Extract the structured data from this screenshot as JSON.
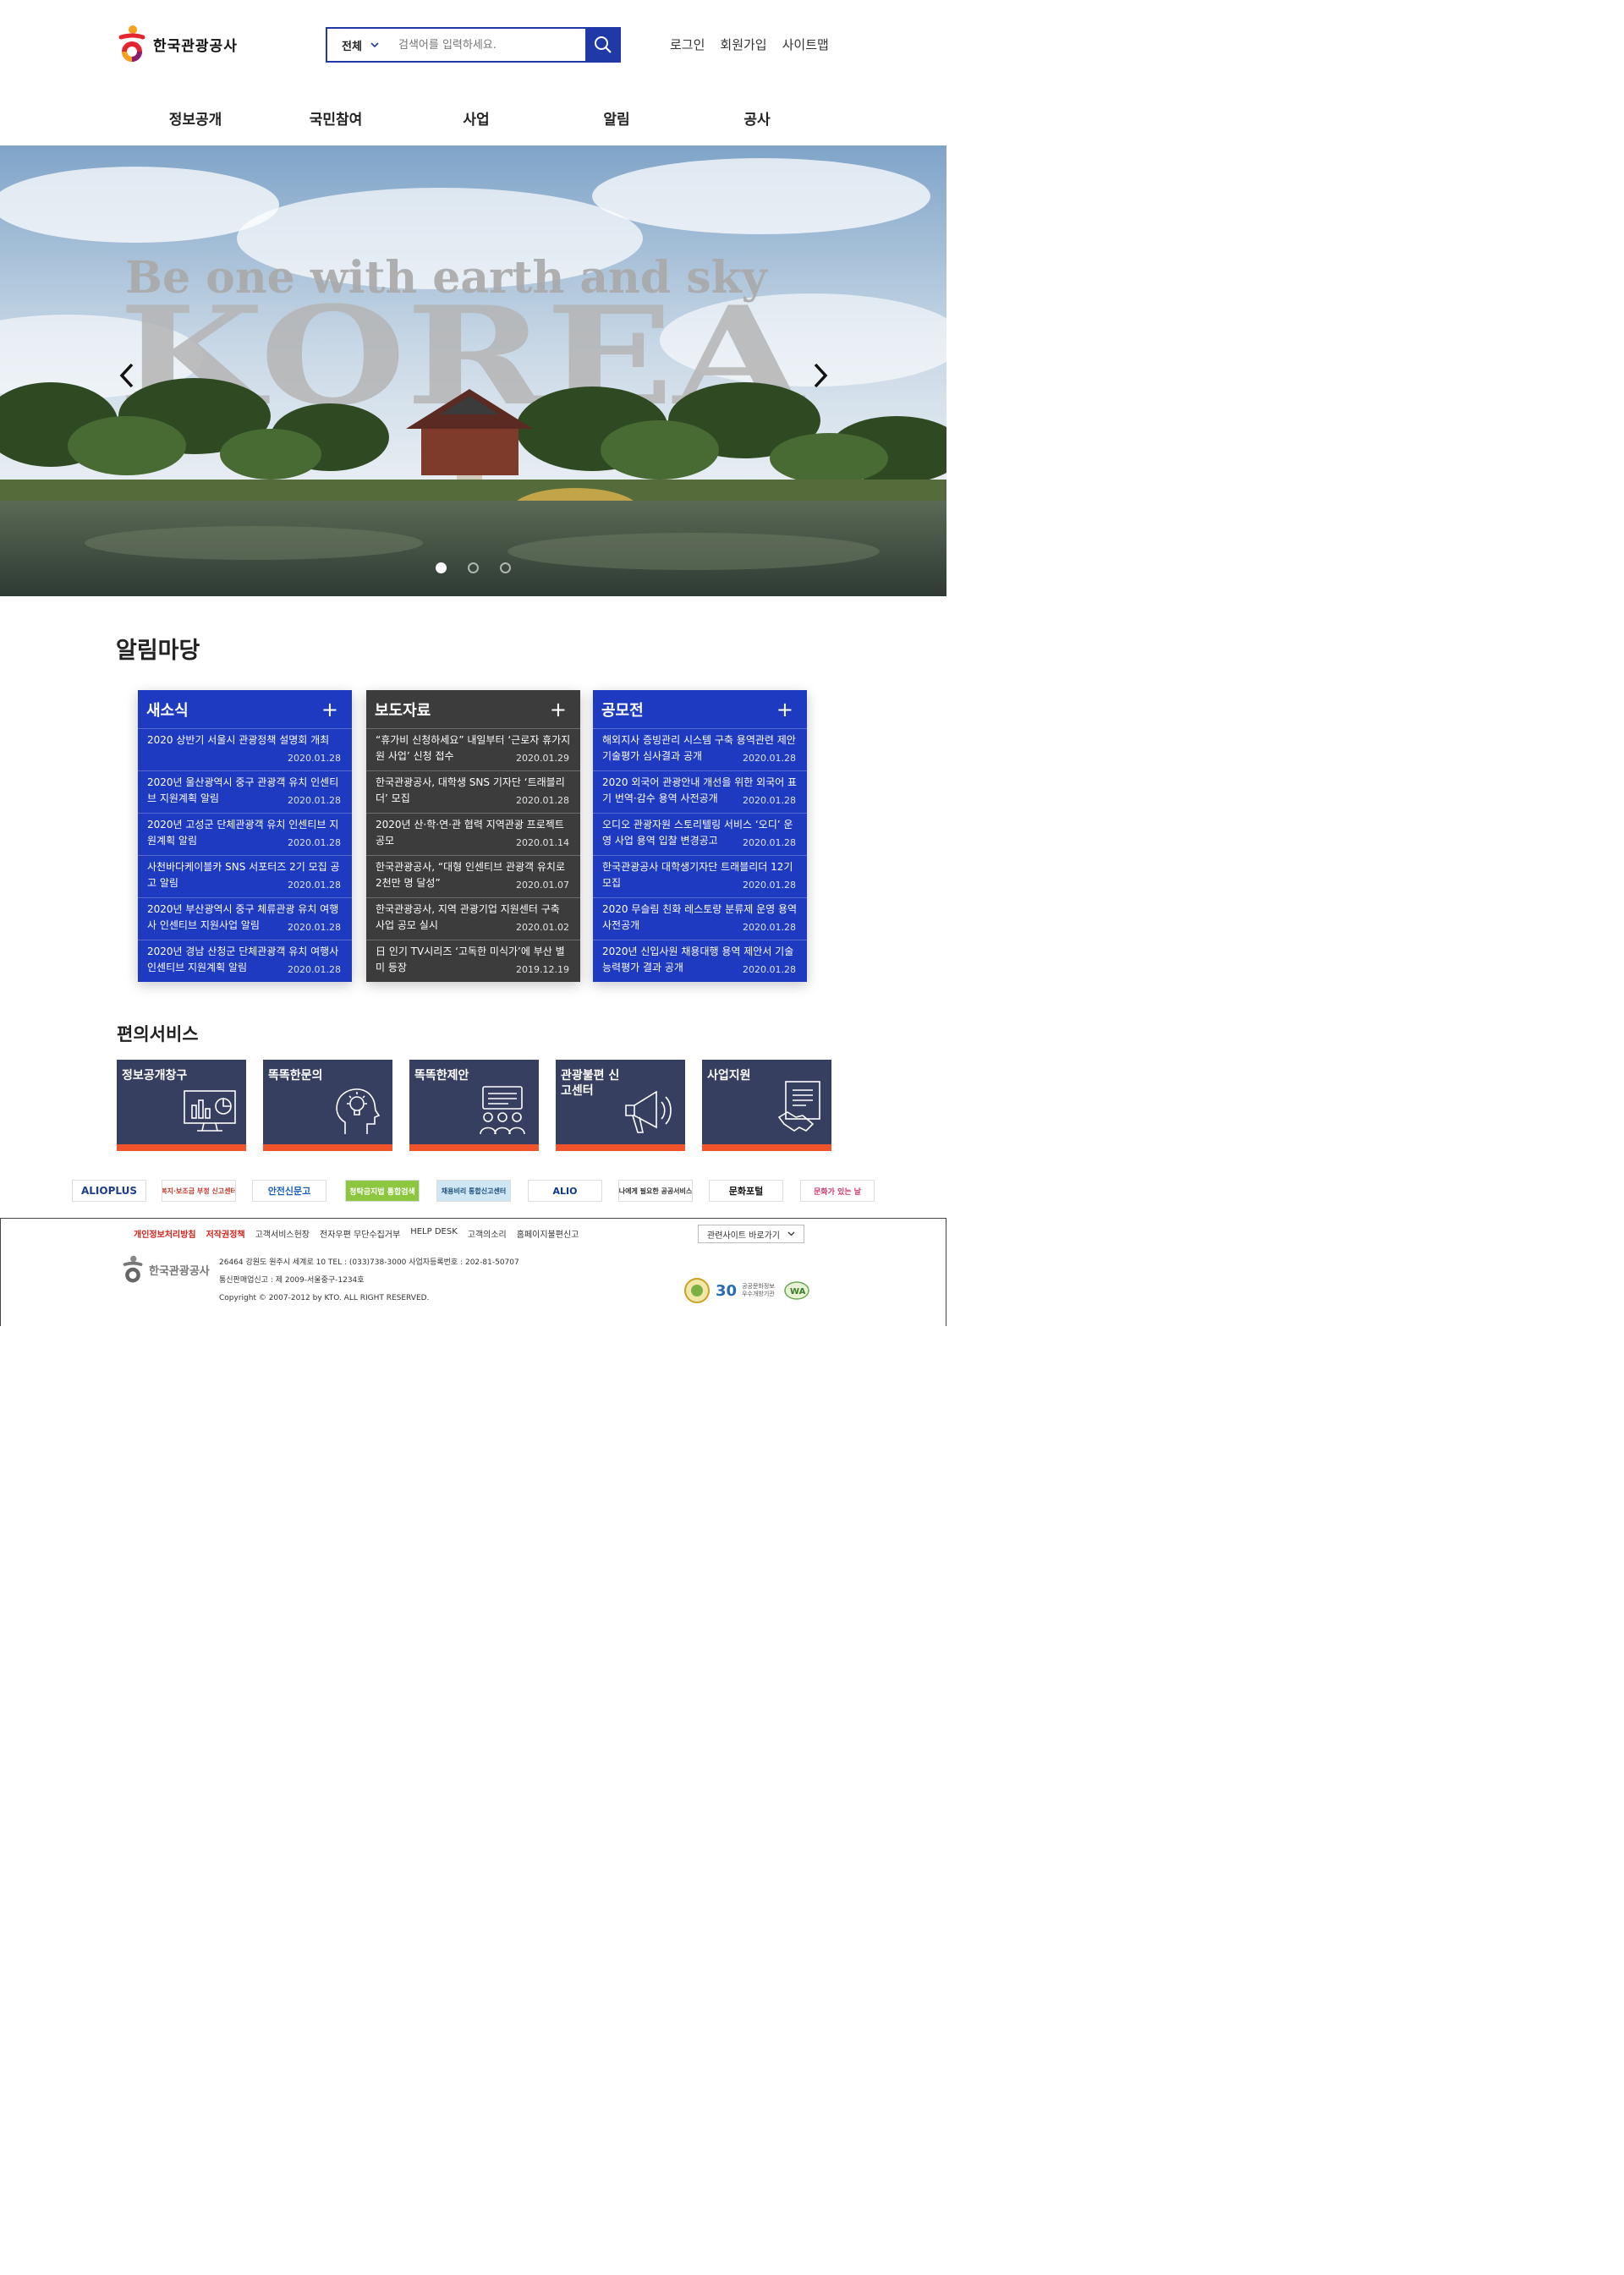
{
  "header": {
    "logo_text": "한국관광공사",
    "search": {
      "scope": "전체",
      "placeholder": "검색어를 입력하세요."
    },
    "util": [
      "로그인",
      "회원가입",
      "사이트맵"
    ],
    "gnb": [
      "정보공개",
      "국민참여",
      "사업",
      "알림",
      "공사"
    ]
  },
  "hero": {
    "tagline": "Be one with earth and sky",
    "headline": "KOREA",
    "slide_count": 3,
    "active_slide": 1
  },
  "notice": {
    "title": "알림마당",
    "boards": [
      {
        "title": "새소식",
        "more": "+",
        "items": [
          {
            "text": "2020 상반기 서울시 관광정책 설명회 개최",
            "date": "2020.01.28"
          },
          {
            "text": "2020년 울산광역시 중구 관광객 유치 인센티브 지원계획 알림",
            "date": "2020.01.28"
          },
          {
            "text": "2020년 고성군 단체관광객 유치 인센티브 지원계획 알림",
            "date": "2020.01.28"
          },
          {
            "text": "사천바다케이블카 SNS 서포터즈 2기 모집 공고 알림",
            "date": "2020.01.28"
          },
          {
            "text": "2020년 부산광역시 중구 체류관광 유치 여행사 인센티브 지원사업 알림",
            "date": "2020.01.28"
          },
          {
            "text": "2020년 경남 산청군 단체관광객 유치 여행사 인센티브 지원계획 알림",
            "date": "2020.01.28"
          }
        ]
      },
      {
        "title": "보도자료",
        "more": "+",
        "items": [
          {
            "text": "“휴가비 신청하세요” 내일부터 ‘근로자 휴가지원 사업’ 신청 접수",
            "date": "2020.01.29"
          },
          {
            "text": "한국관광공사, 대학생 SNS 기자단 ‘트래블리더’ 모집",
            "date": "2020.01.28"
          },
          {
            "text": "2020년 산·학·연·관 협력 지역관광 프로젝트 공모",
            "date": "2020.01.14"
          },
          {
            "text": "한국관광공사, “대형 인센티브 관광객 유치로 2천만 명 달성”",
            "date": "2020.01.07"
          },
          {
            "text": "한국관광공사, 지역 관광기업 지원센터 구축 사업 공모 실시",
            "date": "2020.01.02"
          },
          {
            "text": "日 인기 TV시리즈 ‘고독한 미식가’에 부산 별미 등장",
            "date": "2019.12.19"
          }
        ]
      },
      {
        "title": "공모전",
        "more": "+",
        "items": [
          {
            "text": "해외지사 증빙관리 시스템 구축 용역관련 제안 기술평가 심사결과 공개",
            "date": "2020.01.28"
          },
          {
            "text": "2020 외국어 관광안내 개선을 위한 외국어 표기 번역·감수 용역 사전공개",
            "date": "2020.01.28"
          },
          {
            "text": "오디오 관광자원 스토리텔링 서비스 ‘오디’ 운영 사업 용역 입찰 변경공고",
            "date": "2020.01.28"
          },
          {
            "text": "한국관광공사 대학생기자단 트래블리더 12기 모집",
            "date": "2020.01.28"
          },
          {
            "text": "2020 무슬림 친화 레스토랑 분류제 운영 용역 사전공개",
            "date": "2020.01.28"
          },
          {
            "text": "2020년 신입사원 채용대행 용역 제안서 기술능력평가 결과 공개",
            "date": "2020.01.28"
          }
        ]
      }
    ]
  },
  "services": {
    "title": "편의서비스",
    "items": [
      {
        "label": "정보공개창구",
        "icon": "monitor-chart-icon"
      },
      {
        "label": "똑똑한문의",
        "icon": "head-idea-icon"
      },
      {
        "label": "똑똑한제안",
        "icon": "meeting-board-icon"
      },
      {
        "label": "관광불편 신고센터",
        "icon": "megaphone-icon"
      },
      {
        "label": "사업지원",
        "icon": "handshake-document-icon"
      }
    ]
  },
  "banners": [
    "ALIOPLUS",
    "복지·보조금 부정 신고센터",
    "안전신문고",
    "청탁금지법 통합검색",
    "채용비리 통합신고센터",
    "ALIO",
    "나에게 필요한 공공서비스",
    "문화포털",
    "문화가 있는 날"
  ],
  "footer": {
    "links": [
      "개인정보처리방침",
      "저작권정책",
      "고객서비스헌장",
      "전자우편 무단수집거부",
      "HELP DESK",
      "고객의소리",
      "홈페이지불편신고"
    ],
    "related": "관련사이트 바로가기",
    "address": "26464 강원도 원주시 세계로 10 TEL : (033)738-3000 사업자등록번호 : 202-81-50707",
    "commerce": "통신판매업신고 : 제 2009-서울중구-1234호",
    "copyright": "Copyright © 2007-2012 by KTO. ALL RIGHT RESERVED.",
    "logo_text": "한국관광공사",
    "badges": [
      "30",
      "공공문화정보 우수개방기관"
    ]
  },
  "colors": {
    "primary": "#1d3ac0",
    "dark": "#3c3c3c",
    "service": "#363f5f",
    "accent": "#f1542b"
  }
}
